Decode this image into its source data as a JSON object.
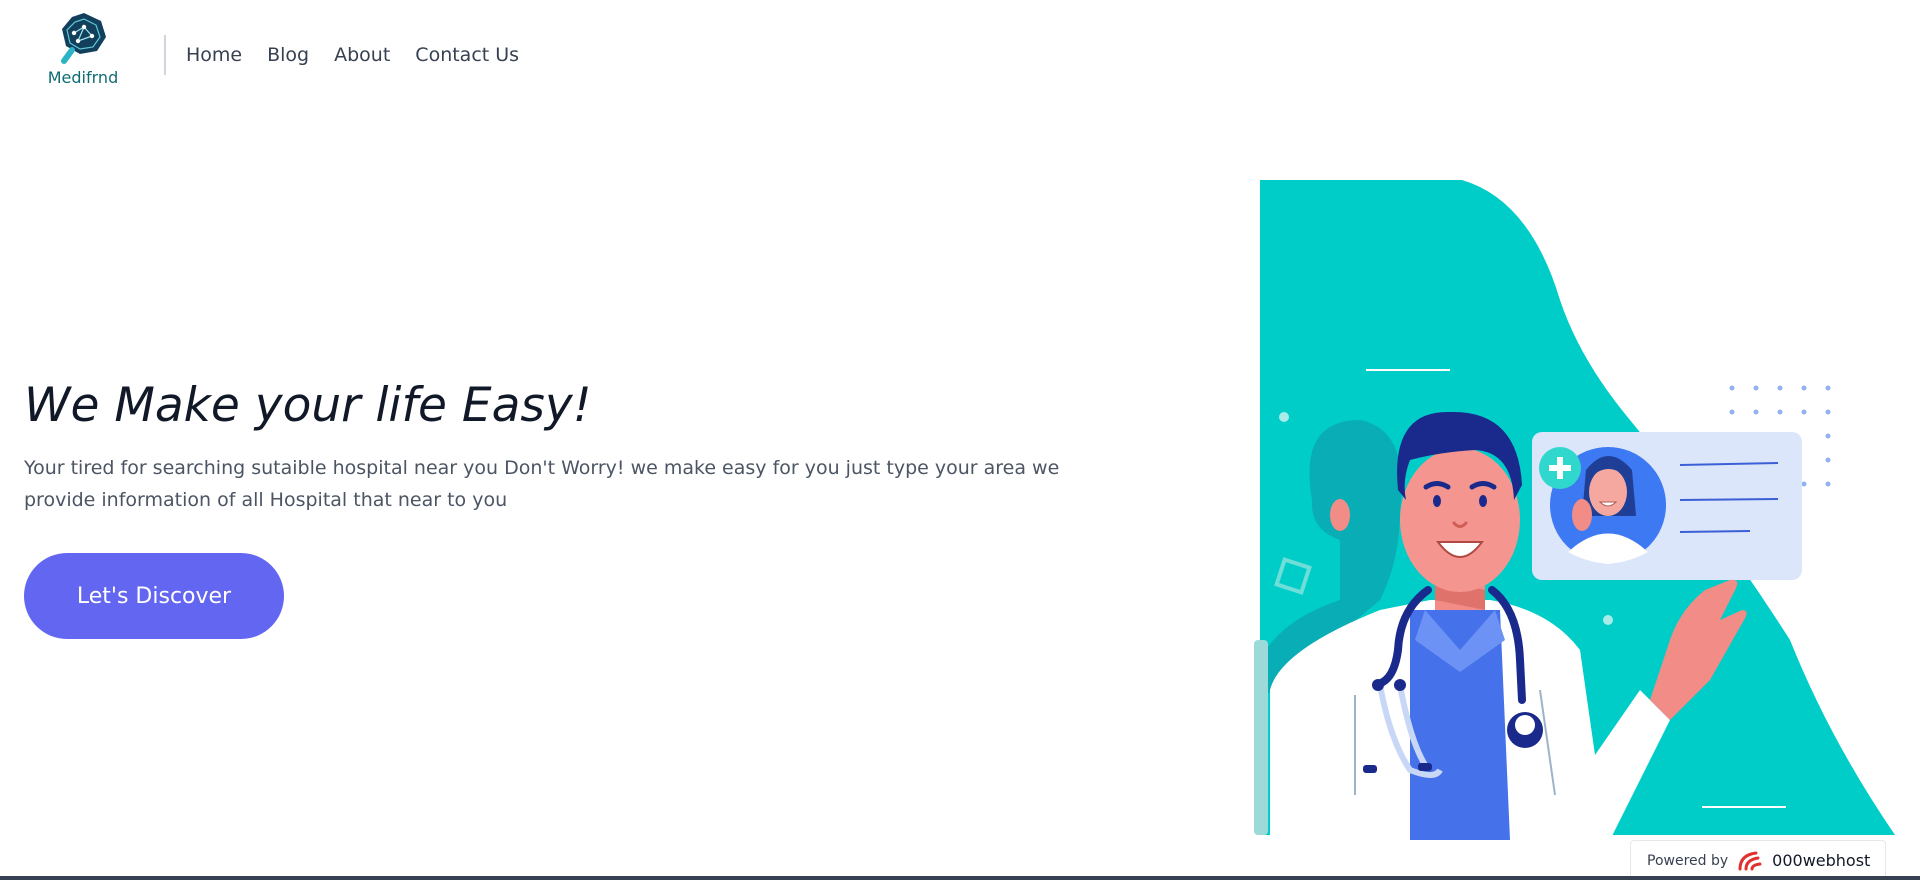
{
  "brand": {
    "name": "Medifrnd",
    "logo_icon": "magnifier-logo-icon"
  },
  "nav": {
    "items": [
      "Home",
      "Blog",
      "About",
      "Contact Us"
    ]
  },
  "hero": {
    "title": "We Make your life Easy!",
    "description": "Your tired for searching sutaible hospital near you Don't Worry! we make easy for you just type your area we provide information of all Hospital that near to you",
    "cta_label": "Let's Discover",
    "illustration": "doctor-with-patient-card-illustration"
  },
  "badge": {
    "prefix": "Powered by",
    "name": "000webhost",
    "logo_icon": "000webhost-logo-icon"
  },
  "colors": {
    "accent": "#6366f1",
    "teal": "#00cdc8",
    "brand_text": "#0f6c74",
    "nav_text": "#374151",
    "title_text": "#111827",
    "body_text": "#4b5563"
  }
}
